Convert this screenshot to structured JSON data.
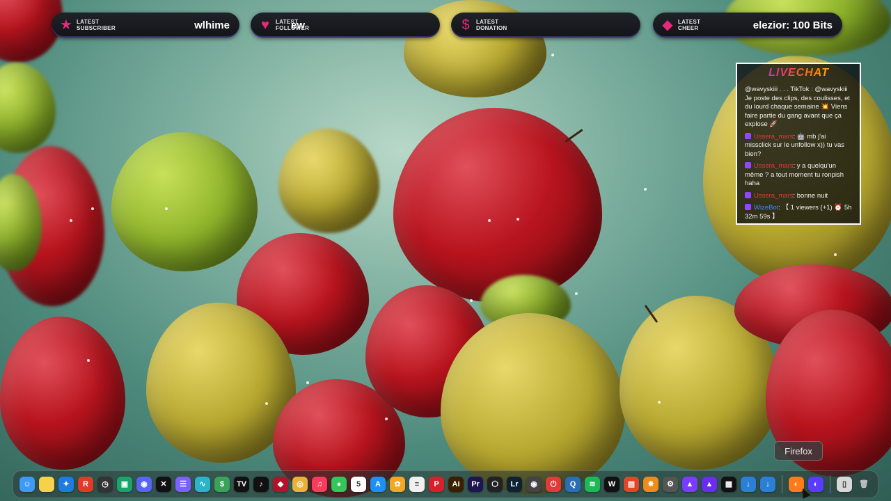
{
  "alerts": [
    {
      "label_line1": "LATEST",
      "label_line2": "SUBSCRIBER",
      "value": "wlhime",
      "icon": "star-icon"
    },
    {
      "label_line1": "LATEST",
      "label_line2": "FOLLOWER",
      "value": "ew",
      "icon": "heart-icon"
    },
    {
      "label_line1": "LATEST",
      "label_line2": "DONATION",
      "value": "",
      "icon": "dollar-icon"
    },
    {
      "label_line1": "LATEST",
      "label_line2": "CHEER",
      "value": "elezior: 100 Bits",
      "icon": "diamond-icon"
    }
  ],
  "chat": {
    "title": "LIVECHAT",
    "messages": [
      {
        "user": "",
        "text": "@wavyskiii . . . TikTok : @wavyskiii Je poste des clips, des coulisses, et du lourd chaque semaine 💥 Viens faire partie du gang avant que ça explose 🚀"
      },
      {
        "user": "Ussera_mars",
        "text": ": 🤖 mb j'ai missclick sur le unfollow x)) tu vas bien?"
      },
      {
        "user": "Ussera_mars",
        "text": ": y a quelqu'un même ? a tout moment tu ronpish haha"
      },
      {
        "user": "Ussera_mars",
        "text": ": bonne nuit"
      },
      {
        "user": "WizeBot",
        "text": ": 【 1 viewers (+1) ⏰ 5h 32m 59s 】"
      }
    ]
  },
  "tooltip": "Firefox",
  "dock": [
    {
      "name": "finder-icon",
      "glyph": "☺",
      "bg": "#3d9bf5"
    },
    {
      "name": "notes-icon",
      "glyph": "",
      "bg": "#f5d24a"
    },
    {
      "name": "gamepad-icon",
      "glyph": "✦",
      "bg": "#1f7be0"
    },
    {
      "name": "app-r-icon",
      "glyph": "R",
      "bg": "#e23a2a"
    },
    {
      "name": "clock-app-icon",
      "glyph": "◷",
      "bg": "#333"
    },
    {
      "name": "android-icon",
      "glyph": "▣",
      "bg": "#1aa36b"
    },
    {
      "name": "discord-icon",
      "glyph": "◉",
      "bg": "#5865f2"
    },
    {
      "name": "capcut-icon",
      "glyph": "✕",
      "bg": "#111"
    },
    {
      "name": "menu-app-icon",
      "glyph": "☰",
      "bg": "#7b61ff"
    },
    {
      "name": "chart-app-icon",
      "glyph": "∿",
      "bg": "#2bb3c9"
    },
    {
      "name": "coin-app-icon",
      "glyph": "$",
      "bg": "#3aa35a"
    },
    {
      "name": "tradingview-icon",
      "glyph": "TV",
      "bg": "#111"
    },
    {
      "name": "tiktok-icon",
      "glyph": "♪",
      "bg": "#111"
    },
    {
      "name": "red-app-icon",
      "glyph": "◆",
      "bg": "#b3122a"
    },
    {
      "name": "chrome-icon",
      "glyph": "◎",
      "bg": "#e8b23a"
    },
    {
      "name": "music-icon",
      "glyph": "♫",
      "bg": "#fa3c5a"
    },
    {
      "name": "messages-icon",
      "glyph": "●",
      "bg": "#33c759"
    },
    {
      "name": "calendar-icon",
      "glyph": "5",
      "bg": "#ffffff"
    },
    {
      "name": "appstore-icon",
      "glyph": "A",
      "bg": "#1e8ff5"
    },
    {
      "name": "photos-icon",
      "glyph": "✿",
      "bg": "#f5a623"
    },
    {
      "name": "reminders-icon",
      "glyph": "≡",
      "bg": "#f0f0f0"
    },
    {
      "name": "acrobat-icon",
      "glyph": "P",
      "bg": "#d8202a"
    },
    {
      "name": "illustrator-icon",
      "glyph": "Ai",
      "bg": "#3a1f00"
    },
    {
      "name": "premiere-icon",
      "glyph": "Pr",
      "bg": "#1f1650"
    },
    {
      "name": "unity-icon",
      "glyph": "⬡",
      "bg": "#222"
    },
    {
      "name": "lightroom-icon",
      "glyph": "Lr",
      "bg": "#0f2233"
    },
    {
      "name": "obs-icon",
      "glyph": "◉",
      "bg": "#444"
    },
    {
      "name": "power-app-icon",
      "glyph": "⏻",
      "bg": "#e03a3a"
    },
    {
      "name": "quicktime-icon",
      "glyph": "Q",
      "bg": "#2a6fb5"
    },
    {
      "name": "spotify-icon",
      "glyph": "≋",
      "bg": "#1db954"
    },
    {
      "name": "waves-icon",
      "glyph": "W",
      "bg": "#111"
    },
    {
      "name": "stack-app-icon",
      "glyph": "▤",
      "bg": "#e2452a"
    },
    {
      "name": "flstudio-icon",
      "glyph": "✸",
      "bg": "#f08a1a"
    },
    {
      "name": "gear-app-icon",
      "glyph": "⚙",
      "bg": "#555"
    },
    {
      "name": "triangle-app-icon",
      "glyph": "▲",
      "bg": "#7a3cff"
    },
    {
      "name": "triangle-app2-icon",
      "glyph": "▲",
      "bg": "#6a2cf0"
    },
    {
      "name": "mixer-app-icon",
      "glyph": "▦",
      "bg": "#111"
    },
    {
      "name": "download-app-icon",
      "glyph": "↓",
      "bg": "#2b7fd5"
    },
    {
      "name": "download-app2-icon",
      "glyph": "↓",
      "bg": "#2b7fd5"
    },
    {
      "sep": true
    },
    {
      "name": "firefox-icon",
      "glyph": "◐",
      "bg": "#ff7a1a"
    },
    {
      "name": "firefox-dev-icon",
      "glyph": "◐",
      "bg": "#5a3cff"
    },
    {
      "sep": true
    },
    {
      "name": "document-icon",
      "glyph": "▯",
      "bg": "#d8d8d8"
    },
    {
      "name": "trash-icon",
      "glyph": "🗑",
      "bg": "transparent"
    }
  ]
}
